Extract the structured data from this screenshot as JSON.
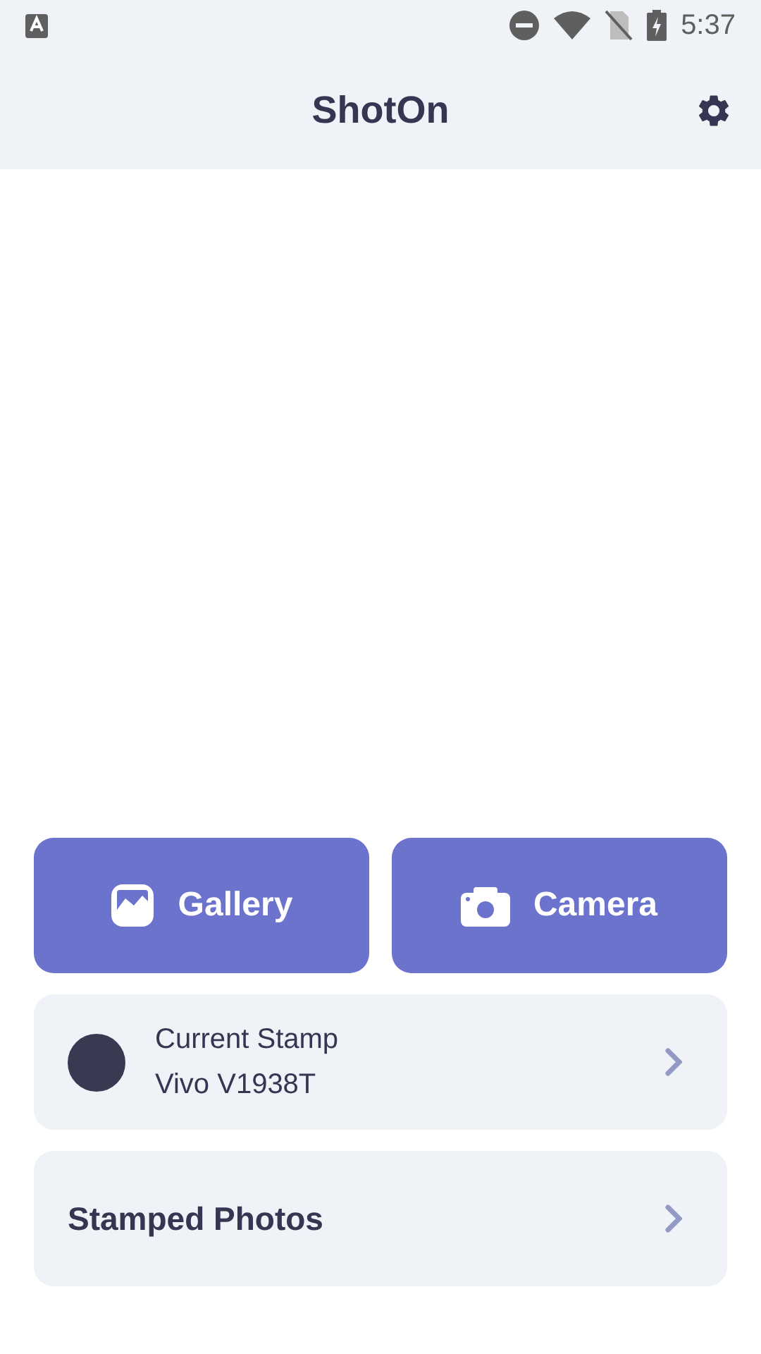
{
  "status_bar": {
    "time": "5:37"
  },
  "app_bar": {
    "title": "ShotOn"
  },
  "actions": [
    {
      "kind": "gallery",
      "label": "Gallery"
    },
    {
      "kind": "camera",
      "label": "Camera"
    }
  ],
  "current_stamp": {
    "label": "Current Stamp",
    "value": "Vivo V1938T"
  },
  "stamped_photos": {
    "label": "Stamped Photos"
  }
}
